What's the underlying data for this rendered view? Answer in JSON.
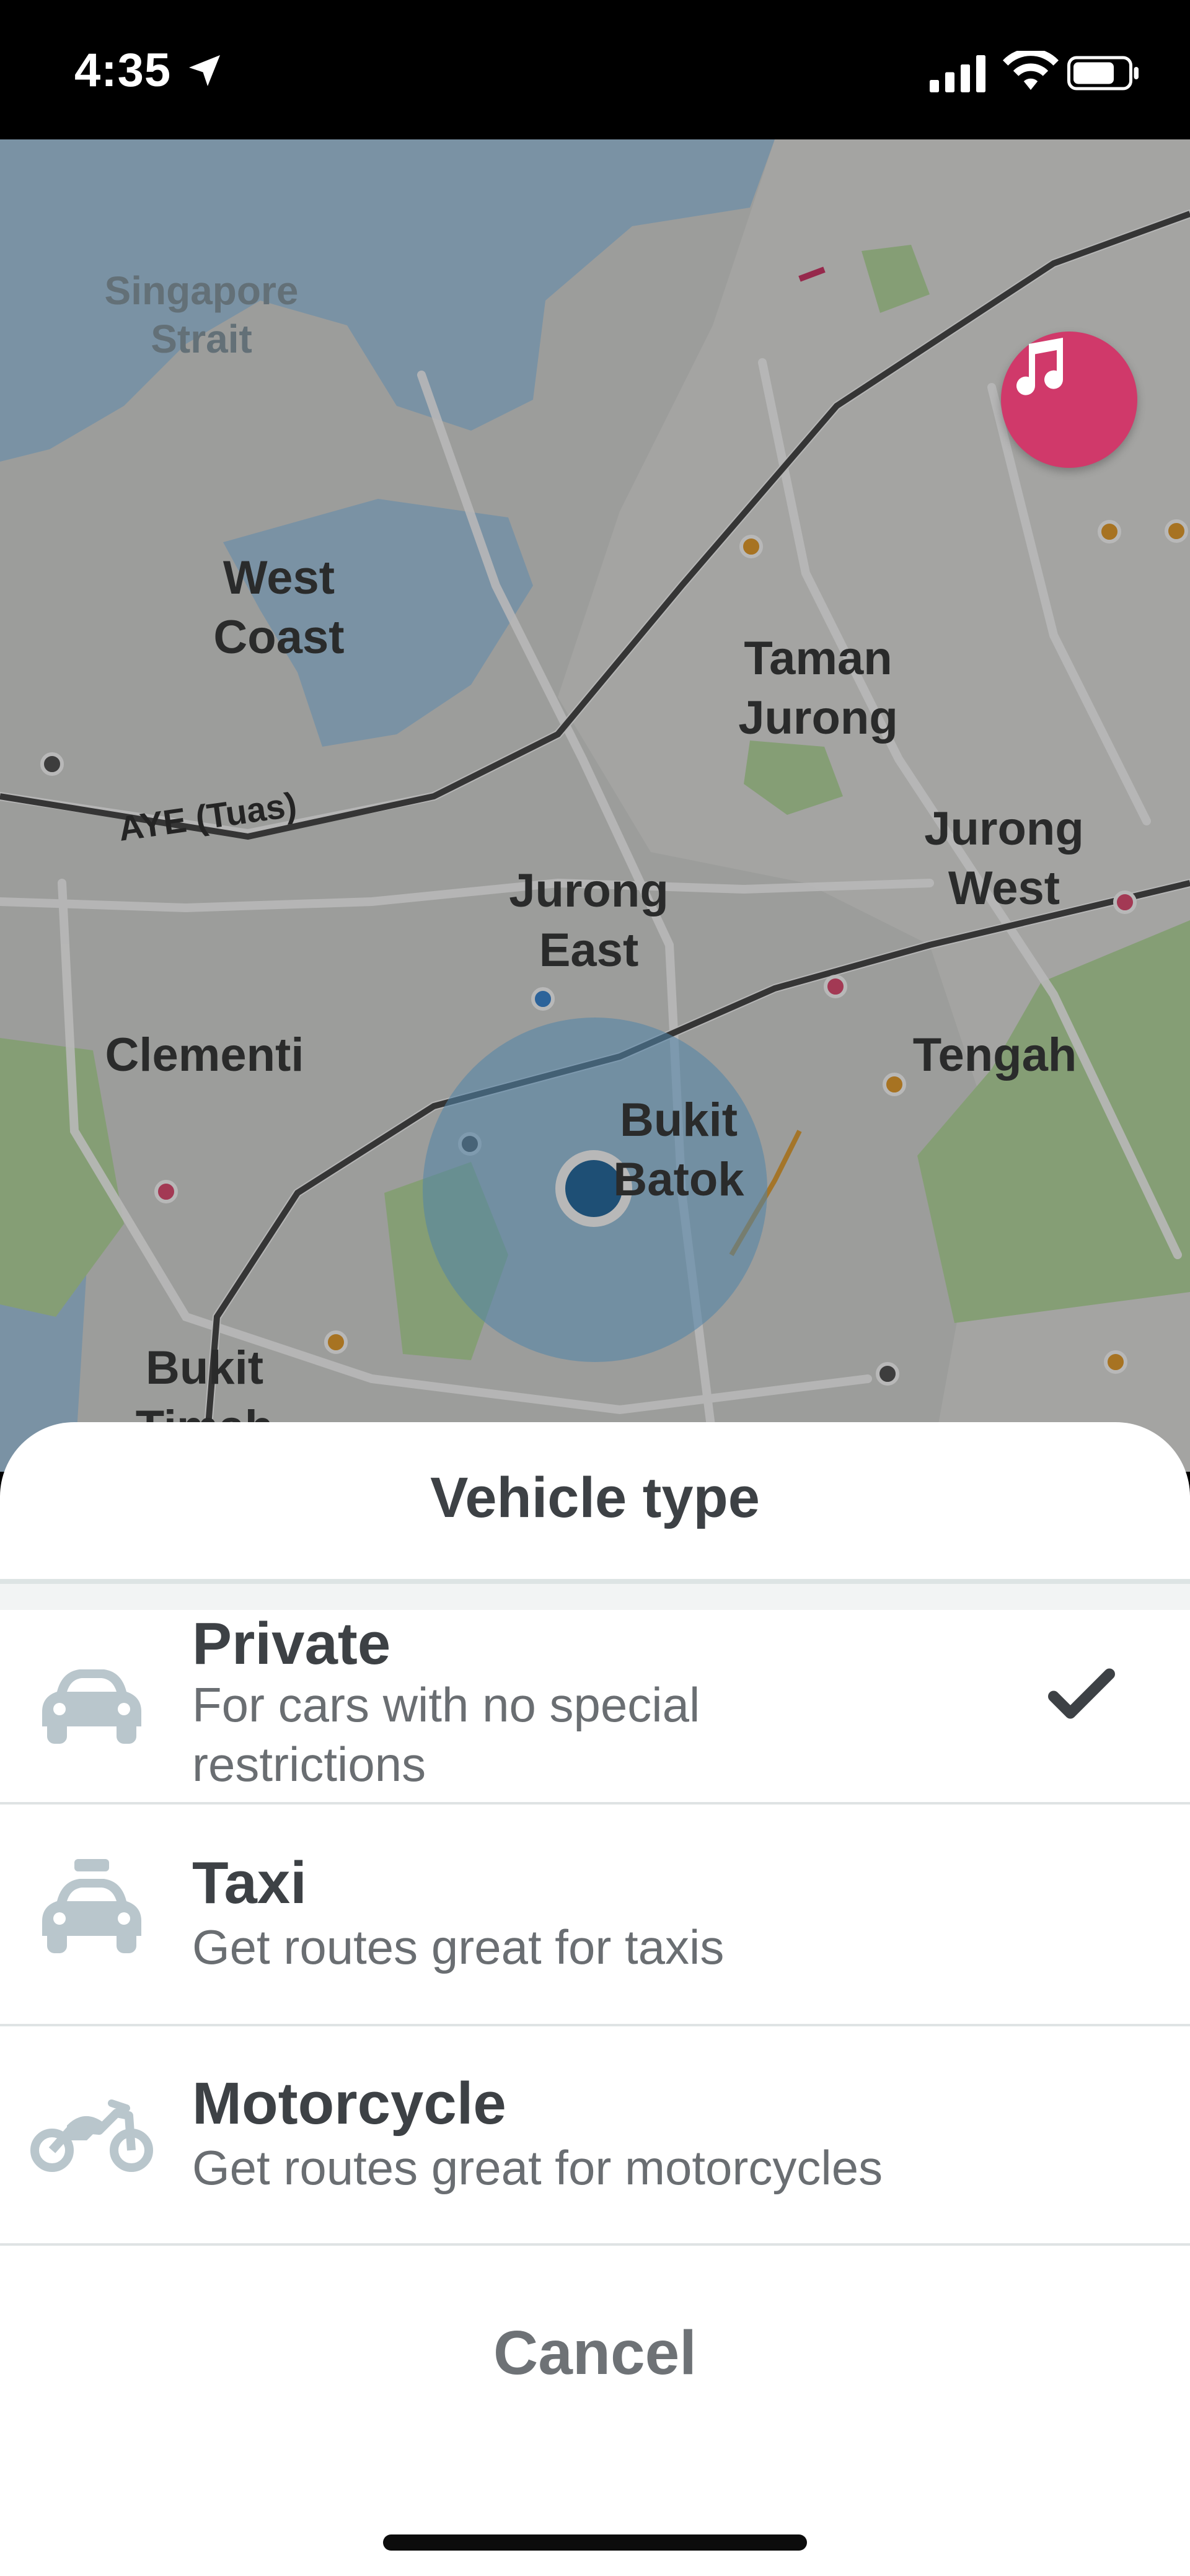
{
  "status_bar": {
    "time": "4:35"
  },
  "map": {
    "labels": {
      "singapore_strait": "Singapore\nStrait",
      "west_coast": "West\nCoast",
      "taman_jurong": "Taman\nJurong",
      "jurong_west": "Jurong\nWest",
      "jurong_east": "Jurong\nEast",
      "clementi": "Clementi",
      "tengah": "Tengah",
      "bukit_batok": "Bukit\nBatok",
      "bukit_timah": "Bukit\nTimah",
      "aye": "AYE (Tuas)"
    }
  },
  "sheet": {
    "title": "Vehicle type",
    "options": [
      {
        "title": "Private",
        "description": "For cars with no special restrictions",
        "selected": true,
        "icon": "car-icon"
      },
      {
        "title": "Taxi",
        "description": "Get routes great for taxis",
        "selected": false,
        "icon": "taxi-icon"
      },
      {
        "title": "Motorcycle",
        "description": "Get routes great for motorcycles",
        "selected": false,
        "icon": "motorcycle-icon"
      }
    ],
    "cancel_label": "Cancel"
  },
  "colors": {
    "accent_music": "#d0396a",
    "text_primary": "#3d4145",
    "text_secondary": "#6a6e72",
    "icon_gray": "#b9c6cc"
  }
}
